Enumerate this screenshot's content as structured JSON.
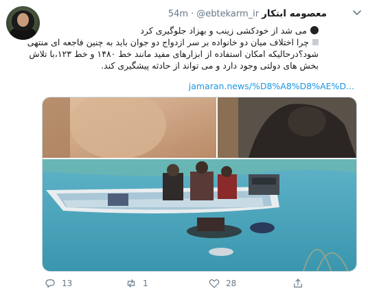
{
  "tweet": {
    "author": {
      "name": "معصومه ابتکار",
      "handle": "@ebtekarm_ir",
      "time": "54m"
    },
    "separator": "·",
    "lines": [
      "می شد از خودکشی زینب و بهزاد جلوگیری کرد",
      "چرا اختلاف میان دو خانواده بر سر ازدواج دو جوان باید به چنین فاجعه ای منتهی",
      "شود؟درحالیکه امکان استفاده از ابزارهای مفید مانند خط ۱۴۸۰ و خط ۱۲۳،با تلاش",
      "بخش های دولتی وجود دارد و می تواند از حادثه پیشگیری کند."
    ],
    "link": "jamaran.news/%D8%A8%D8%AE%D...",
    "actions": {
      "reply_count": "13",
      "retweet_count": "1",
      "like_count": "28"
    }
  },
  "icons": {
    "bullet": "black-circle-emoji",
    "square": "small-square-emoji",
    "more": "chevron-down-icon",
    "reply": "reply-icon",
    "retweet": "retweet-icon",
    "like": "heart-icon",
    "share": "share-icon"
  },
  "colors": {
    "link": "#1b95e0",
    "secondary_text": "#657786",
    "border": "#ccd6dd"
  }
}
